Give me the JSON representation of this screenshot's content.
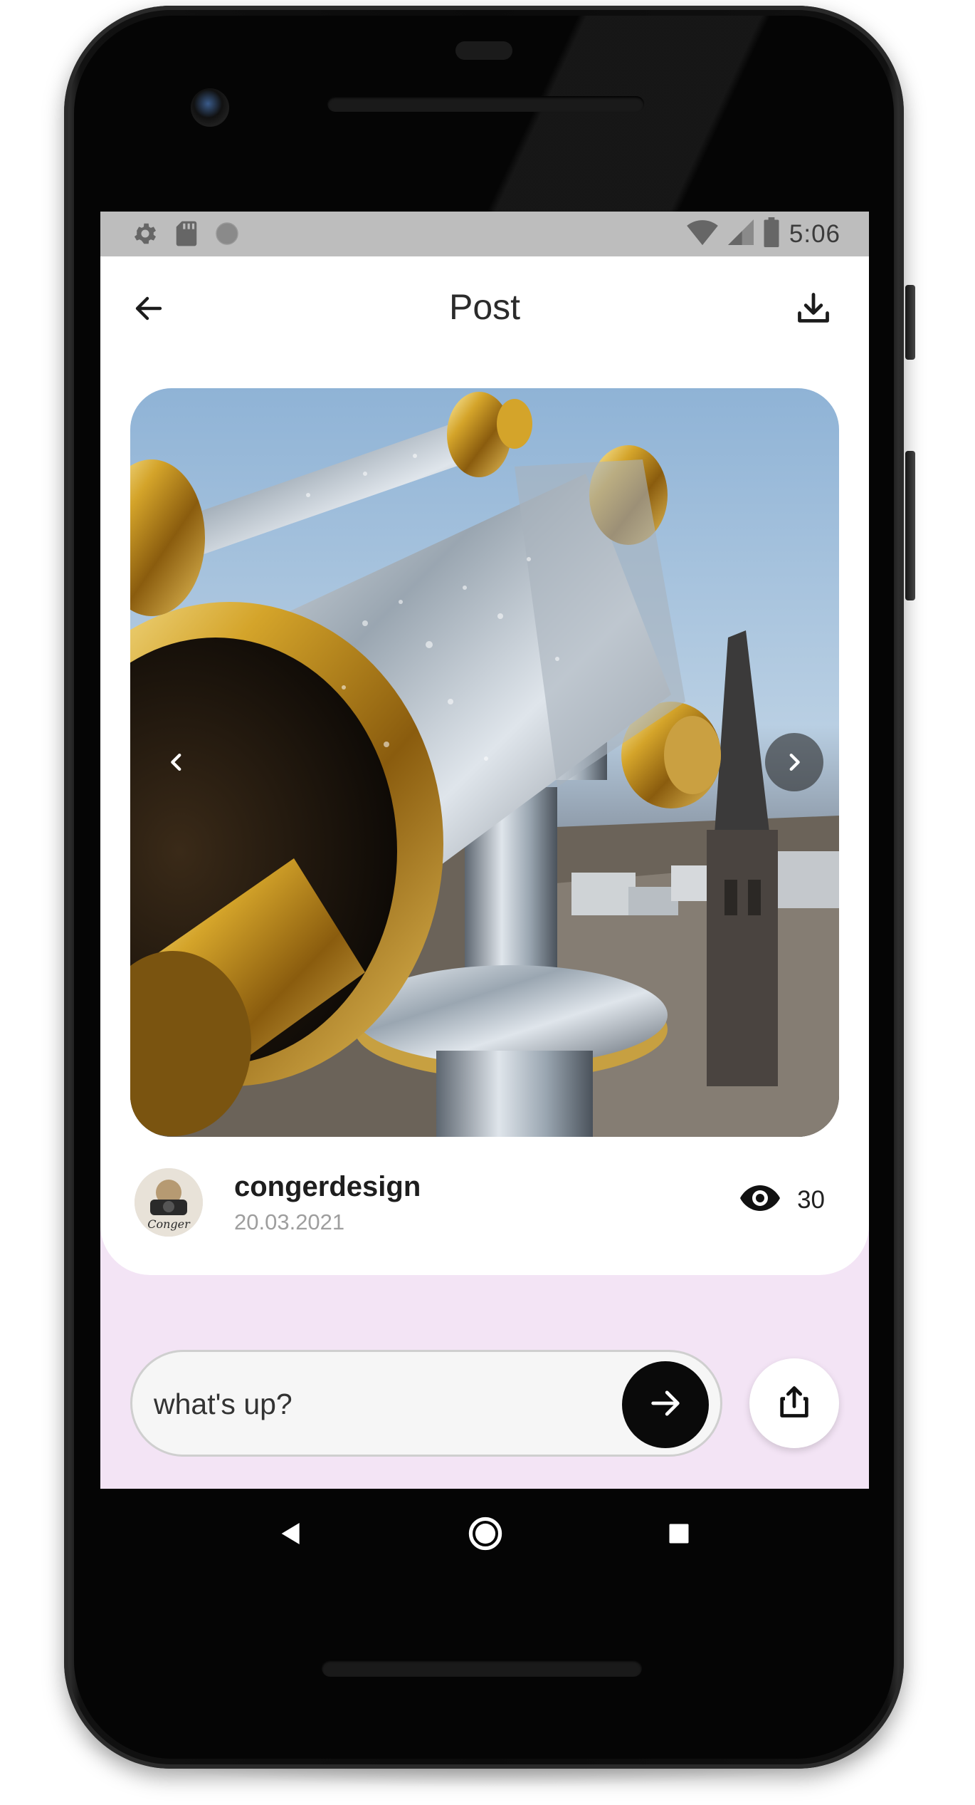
{
  "status_bar": {
    "time": "5:06",
    "icons_left": [
      "gear-icon",
      "sd-card-icon",
      "circle-icon"
    ],
    "icons_right": [
      "wifi-icon",
      "signal-icon",
      "battery-icon"
    ]
  },
  "app_bar": {
    "title": "Post",
    "back_icon": "arrow-left-icon",
    "download_icon": "download-icon"
  },
  "post": {
    "image_description": "coin-operated binoculars with brass fittings overlooking a town with a church spire",
    "prev_icon": "chevron-left-icon",
    "next_icon": "chevron-right-icon",
    "author": {
      "username": "congerdesign",
      "date": "20.03.2021",
      "avatar_text": "Conger"
    },
    "views": {
      "icon": "eye-icon",
      "count": "30"
    }
  },
  "composer": {
    "placeholder": "what's up?",
    "send_icon": "arrow-right-icon",
    "share_icon": "share-icon"
  },
  "system_nav": {
    "back": "triangle-back-icon",
    "home": "circle-home-icon",
    "recents": "square-recents-icon"
  },
  "colors": {
    "background_tint": "#f3e4f5",
    "status_bar": "#bdbdbd",
    "send_button": "#0a0a0a",
    "card": "#ffffff"
  }
}
